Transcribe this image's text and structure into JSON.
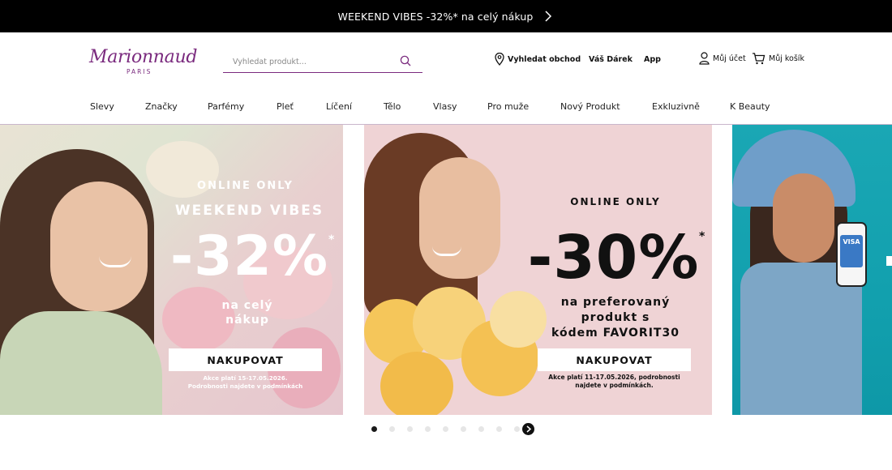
{
  "promo": {
    "text": "WEEKEND VIBES -32%* na celý nákup",
    "arrow_icon": "chevron-right-icon"
  },
  "header": {
    "logo": {
      "name": "Marionnaud",
      "sub": "PARIS"
    },
    "search": {
      "placeholder": "Vyhledat produkt..."
    },
    "store_link": "Vyhledat obchod",
    "gift_link": "Váš Dárek",
    "app_link": "App",
    "account_link": "Můj účet",
    "cart_link": "Můj košík"
  },
  "nav": {
    "items": [
      {
        "label": "Slevy"
      },
      {
        "label": "Značky"
      },
      {
        "label": "Parfémy"
      },
      {
        "label": "Pleť"
      },
      {
        "label": "Líčení"
      },
      {
        "label": "Tělo"
      },
      {
        "label": "Vlasy"
      },
      {
        "label": "Pro muže"
      },
      {
        "label": "Nový Produkt"
      },
      {
        "label": "Exkluzivně"
      },
      {
        "label": "K Beauty"
      }
    ]
  },
  "hero": {
    "slides": [
      {
        "eyebrow": "ONLINE ONLY",
        "title": "WEEKEND VIBES",
        "discount": "-32%",
        "asterisk": "*",
        "subtitle_1": "na celý",
        "subtitle_2": "nákup",
        "cta": "NAKUPOVAT",
        "note_1": "Akce platí 15-17.05.2026.",
        "note_2": "Podrobnosti najdete v podmínkách"
      },
      {
        "eyebrow": "ONLINE ONLY",
        "discount": "-30%",
        "asterisk": "*",
        "subtitle_1": "na preferovaný",
        "subtitle_2": "produkt s",
        "subtitle_3_prefix": "kódem ",
        "subtitle_3_code": "FAVORIT30",
        "cta": "NAKUPOVAT",
        "note_1": "Akce platí 11-17.05.2026, podrobnosti",
        "note_2": "najdete v podmínkách."
      },
      {
        "card_text": "VISA"
      }
    ],
    "dot_count": 9,
    "active_dot": 1
  },
  "colors": {
    "brand": "#7a2a7e",
    "promo_bg": "#000000",
    "accent_teal": "#12a0ae"
  }
}
